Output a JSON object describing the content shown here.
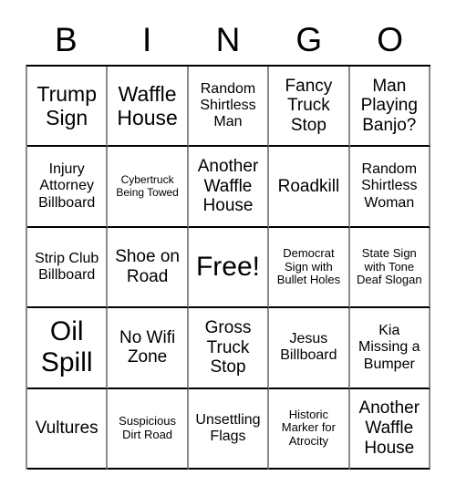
{
  "header": {
    "letters": [
      "B",
      "I",
      "N",
      "G",
      "O"
    ]
  },
  "grid": {
    "rows": [
      [
        {
          "text": "Trump Sign",
          "size": "fs-lg"
        },
        {
          "text": "Waffle House",
          "size": "fs-lg"
        },
        {
          "text": "Random Shirtless Man",
          "size": "fs-sm"
        },
        {
          "text": "Fancy Truck Stop",
          "size": "fs-md"
        },
        {
          "text": "Man Playing Banjo?",
          "size": "fs-md"
        }
      ],
      [
        {
          "text": "Injury Attorney Billboard",
          "size": "fs-sm"
        },
        {
          "text": "Cybertruck Being Towed",
          "size": "fs-xxs"
        },
        {
          "text": "Another Waffle House",
          "size": "fs-md"
        },
        {
          "text": "Roadkill",
          "size": "fs-md"
        },
        {
          "text": "Random Shirtless Woman",
          "size": "fs-sm"
        }
      ],
      [
        {
          "text": "Strip Club Billboard",
          "size": "fs-sm"
        },
        {
          "text": "Shoe on Road",
          "size": "fs-md"
        },
        {
          "text": "Free!",
          "size": "fs-xl"
        },
        {
          "text": "Democrat Sign with Bullet Holes",
          "size": "fs-xs"
        },
        {
          "text": "State Sign with Tone Deaf Slogan",
          "size": "fs-xs"
        }
      ],
      [
        {
          "text": "Oil Spill",
          "size": "fs-xl"
        },
        {
          "text": "No Wifi Zone",
          "size": "fs-md"
        },
        {
          "text": "Gross Truck Stop",
          "size": "fs-md"
        },
        {
          "text": "Jesus Billboard",
          "size": "fs-sm"
        },
        {
          "text": "Kia Missing a Bumper",
          "size": "fs-sm"
        }
      ],
      [
        {
          "text": "Vultures",
          "size": "fs-md"
        },
        {
          "text": "Suspicious Dirt Road",
          "size": "fs-xs"
        },
        {
          "text": "Unsettling Flags",
          "size": "fs-sm"
        },
        {
          "text": "Historic Marker for Atrocity",
          "size": "fs-xs"
        },
        {
          "text": "Another Waffle House",
          "size": "fs-md"
        }
      ]
    ]
  },
  "colors": {
    "background": "#ffffff",
    "text": "#000000",
    "border_horizontal": "#000000",
    "border_vertical": "#8a8a8a"
  }
}
